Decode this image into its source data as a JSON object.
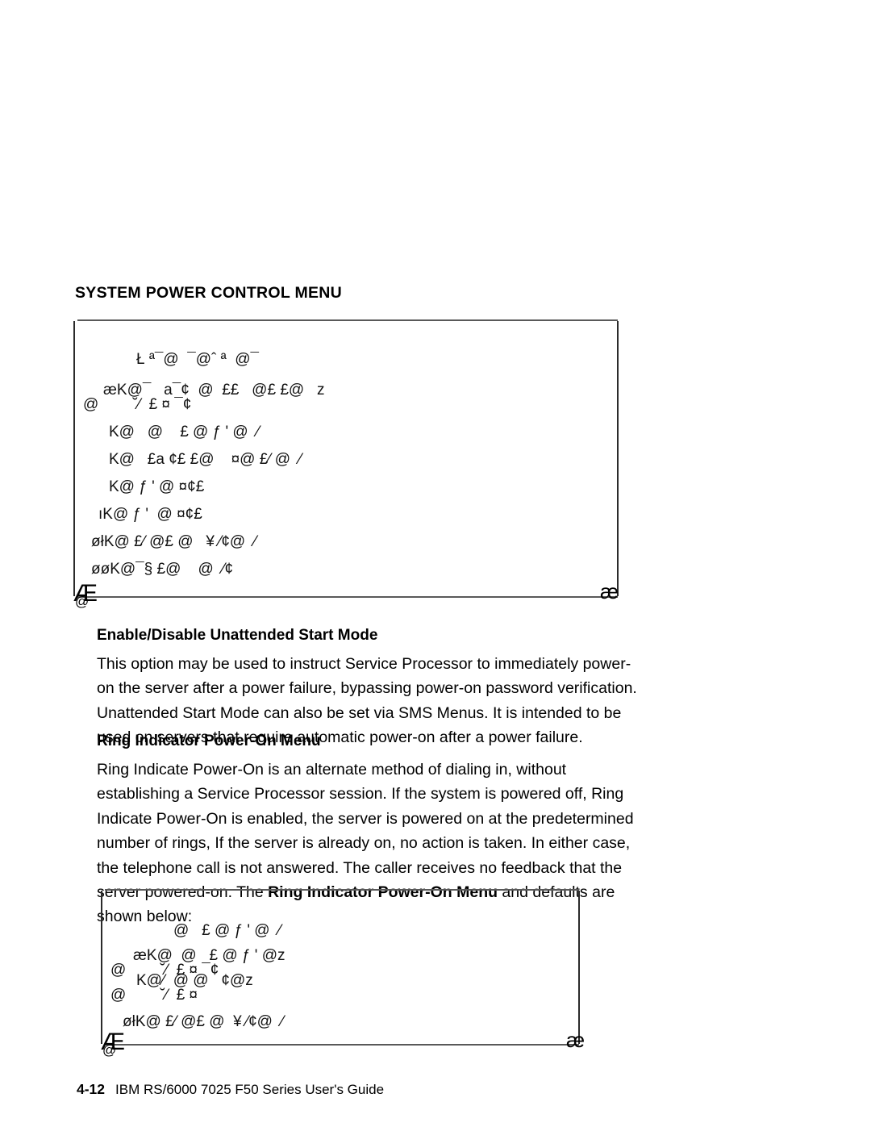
{
  "page": {
    "heading": "SYSTEM POWER CONTROL MENU",
    "footer": {
      "folio": "4-12",
      "title": "IBM RS/6000 7025 F50 Series User's Guide"
    }
  },
  "menu_capture_top": {
    "name": "system-power-control-menu-capture",
    "corner_top_left_glyph": "Æ",
    "corner_at_glyph": "@",
    "corner_bottom_right_glyph": "æ",
    "lines": [
      "Ł ª¯@  ¯@ˆ ª  @¯",
      "æK@¯   a¯¢  @  ££   @£ £@   z",
      "@        ˘⁄  £ ¤ ¯¢",
      "K@   @    £ @ ƒ ' @  ⁄",
      "K@   £a ¢£ £@    ¤@ £⁄ @  ⁄",
      "K@ ƒ ' @ ¤¢£",
      "ıK@ ƒ '  @ ¤¢£",
      "øłK@ £⁄ @£ @   ¥ ⁄¢@  ⁄",
      "øøK@¯§ £@    @  ⁄¢"
    ]
  },
  "section_unattended": {
    "heading": "Enable/Disable Unattended Start Mode",
    "body": "This option may be used to instruct Service Processor to immediately power-on the server after a power failure, bypassing power-on password verification. Unattended Start Mode can also be set via SMS Menus.  It is intended to be used on servers that require automatic power-on after a power failure."
  },
  "section_ring_indicator": {
    "heading": "Ring Indicator Power-On Menu",
    "body_part1": "Ring Indicate Power-On is an alternate method of dialing in, without establishing a Service Processor session.  If the system is powered off, Ring Indicate Power-On is enabled, the server is powered on at the predetermined number of rings, If the server is already on, no action is taken. In either case, the telephone call is not answered. The caller receives no feedback that the server powered-on.  The ",
    "body_emphasis": "Ring Indicator Power-On Menu",
    "body_part2": " and defaults are shown below:"
  },
  "menu_capture_bottom": {
    "name": "ring-indicator-power-on-menu-capture",
    "corner_top_left_glyph": "Æ",
    "corner_at_glyph": "@",
    "corner_bottom_right_glyph": "æ",
    "lines": [
      "@   £ @ ƒ ' @  ⁄",
      "æK@  @   £ @ ƒ ' @z",
      "@        ˘⁄  £ ¤ ¯¢",
      "K@⁄  @ @   ¢@z",
      "@        ˘⁄  £ ¤",
      "øłK@ £⁄ @£ @  ¥ ⁄¢@  ⁄"
    ]
  }
}
